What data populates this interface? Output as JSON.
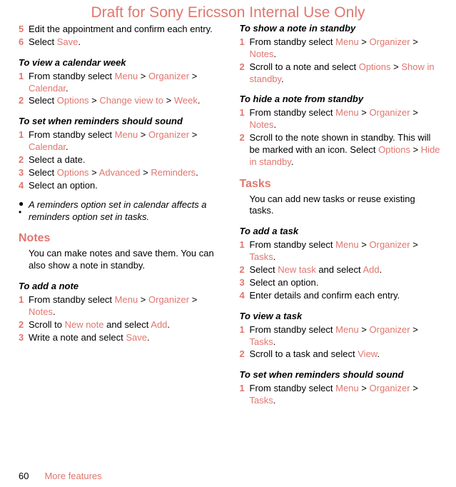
{
  "watermark": "Draft for Sony Ericsson Internal Use Only",
  "footer": {
    "page": "60",
    "section": "More features"
  },
  "left": {
    "s5": {
      "n": "5",
      "t": "Edit the appointment and confirm each entry."
    },
    "s6": {
      "n": "6",
      "pre": "Select ",
      "l1": "Save",
      "post": "."
    },
    "h_viewweek": "To view a calendar week",
    "vw1": {
      "n": "1",
      "pre": "From standby select ",
      "l1": "Menu",
      "sep1": " > ",
      "l2": "Organizer",
      "sep2": " > ",
      "l3": "Calendar",
      "post": "."
    },
    "vw2": {
      "n": "2",
      "pre": "Select ",
      "l1": "Options",
      "sep1": " > ",
      "l2": "Change view to",
      "sep2": " > ",
      "l3": "Week",
      "post": "."
    },
    "h_rem": "To set when reminders should sound",
    "r1": {
      "n": "1",
      "pre": "From standby select ",
      "l1": "Menu",
      "sep1": " > ",
      "l2": "Organizer",
      "sep2": " > ",
      "l3": "Calendar",
      "post": "."
    },
    "r2": {
      "n": "2",
      "t": "Select a date."
    },
    "r3": {
      "n": "3",
      "pre": "Select ",
      "l1": "Options",
      "sep1": " > ",
      "l2": "Advanced",
      "sep2": " > ",
      "l3": "Reminders",
      "post": "."
    },
    "r4": {
      "n": "4",
      "t": "Select an option."
    },
    "note": "A reminders option set in calendar affects a reminders option set in tasks.",
    "h_notes": "Notes",
    "notes_p": "You can make notes and save them. You can also show a note in standby.",
    "h_addnote": "To add a note",
    "an1": {
      "n": "1",
      "pre": "From standby select ",
      "l1": "Menu",
      "sep1": " > ",
      "l2": "Organizer",
      "sep2": " > ",
      "l3": "Notes",
      "post": "."
    },
    "an2": {
      "n": "2",
      "pre": "Scroll to ",
      "l1": "New note",
      "mid": " and select ",
      "l2": "Add",
      "post": "."
    },
    "an3": {
      "n": "3",
      "pre": "Write a note and select ",
      "l1": "Save",
      "post": "."
    }
  },
  "right": {
    "h_show": "To show a note in standby",
    "sh1": {
      "n": "1",
      "pre": "From standby select ",
      "l1": "Menu",
      "sep1": " > ",
      "l2": "Organizer",
      "sep2": " > ",
      "l3": "Notes",
      "post": "."
    },
    "sh2": {
      "n": "2",
      "pre": "Scroll to a note and select ",
      "l1": "Options",
      "sep1": " > ",
      "l2": "Show in standby",
      "post": "."
    },
    "h_hide": "To hide a note from standby",
    "hd1": {
      "n": "1",
      "pre": "From standby select ",
      "l1": "Menu",
      "sep1": " > ",
      "l2": "Organizer",
      "sep2": " > ",
      "l3": "Notes",
      "post": "."
    },
    "hd2": {
      "n": "2",
      "pre": "Scroll to the note shown in standby. This will be marked with an icon. Select ",
      "l1": "Options",
      "sep1": " > ",
      "l2": "Hide in standby",
      "post": "."
    },
    "h_tasks": "Tasks",
    "tasks_p": "You can add new tasks or reuse existing tasks.",
    "h_addtask": "To add a task",
    "at1": {
      "n": "1",
      "pre": "From standby select ",
      "l1": "Menu",
      "sep1": " > ",
      "l2": "Organizer",
      "sep2": " > ",
      "l3": "Tasks",
      "post": "."
    },
    "at2": {
      "n": "2",
      "pre": "Select ",
      "l1": "New task",
      "mid": " and select ",
      "l2": "Add",
      "post": "."
    },
    "at3": {
      "n": "3",
      "t": "Select an option."
    },
    "at4": {
      "n": "4",
      "t": "Enter details and confirm each entry."
    },
    "h_viewtask": "To view a task",
    "vt1": {
      "n": "1",
      "pre": "From standby select ",
      "l1": "Menu",
      "sep1": " > ",
      "l2": "Organizer",
      "sep2": " > ",
      "l3": "Tasks",
      "post": "."
    },
    "vt2": {
      "n": "2",
      "pre": "Scroll to a task and select ",
      "l1": "View",
      "post": "."
    },
    "h_trem": "To set when reminders should sound",
    "tr1": {
      "n": "1",
      "pre": "From standby select ",
      "l1": "Menu",
      "sep1": " > ",
      "l2": "Organizer",
      "sep2": " > ",
      "l3": "Tasks",
      "post": "."
    }
  }
}
